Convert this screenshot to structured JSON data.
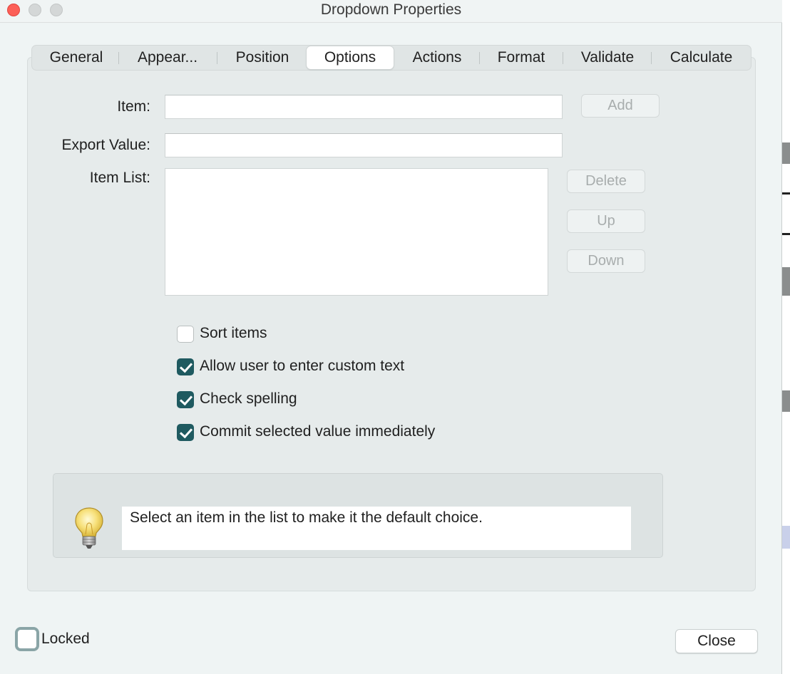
{
  "window": {
    "title": "Dropdown Properties"
  },
  "tabs": [
    {
      "label": "General",
      "active": false
    },
    {
      "label": "Appear...",
      "active": false
    },
    {
      "label": "Position",
      "active": false
    },
    {
      "label": "Options",
      "active": true
    },
    {
      "label": "Actions",
      "active": false
    },
    {
      "label": "Format",
      "active": false
    },
    {
      "label": "Validate",
      "active": false
    },
    {
      "label": "Calculate",
      "active": false
    }
  ],
  "form": {
    "item_label": "Item:",
    "item_value": "",
    "export_label": "Export Value:",
    "export_value": "",
    "item_list_label": "Item List:",
    "item_list": []
  },
  "buttons": {
    "add": "Add",
    "delete": "Delete",
    "up": "Up",
    "down": "Down",
    "close": "Close"
  },
  "options": [
    {
      "label": "Sort items",
      "checked": false
    },
    {
      "label": "Allow user to enter custom text",
      "checked": true
    },
    {
      "label": "Check spelling",
      "checked": true
    },
    {
      "label": "Commit selected value immediately",
      "checked": true
    }
  ],
  "hint": {
    "icon": "lightbulb-icon",
    "text": "Select an item in the list to make it the default choice."
  },
  "locked": {
    "label": "Locked",
    "checked": false
  },
  "colors": {
    "accent_check": "#1f5a60",
    "close_traffic": "#fc5f57"
  }
}
